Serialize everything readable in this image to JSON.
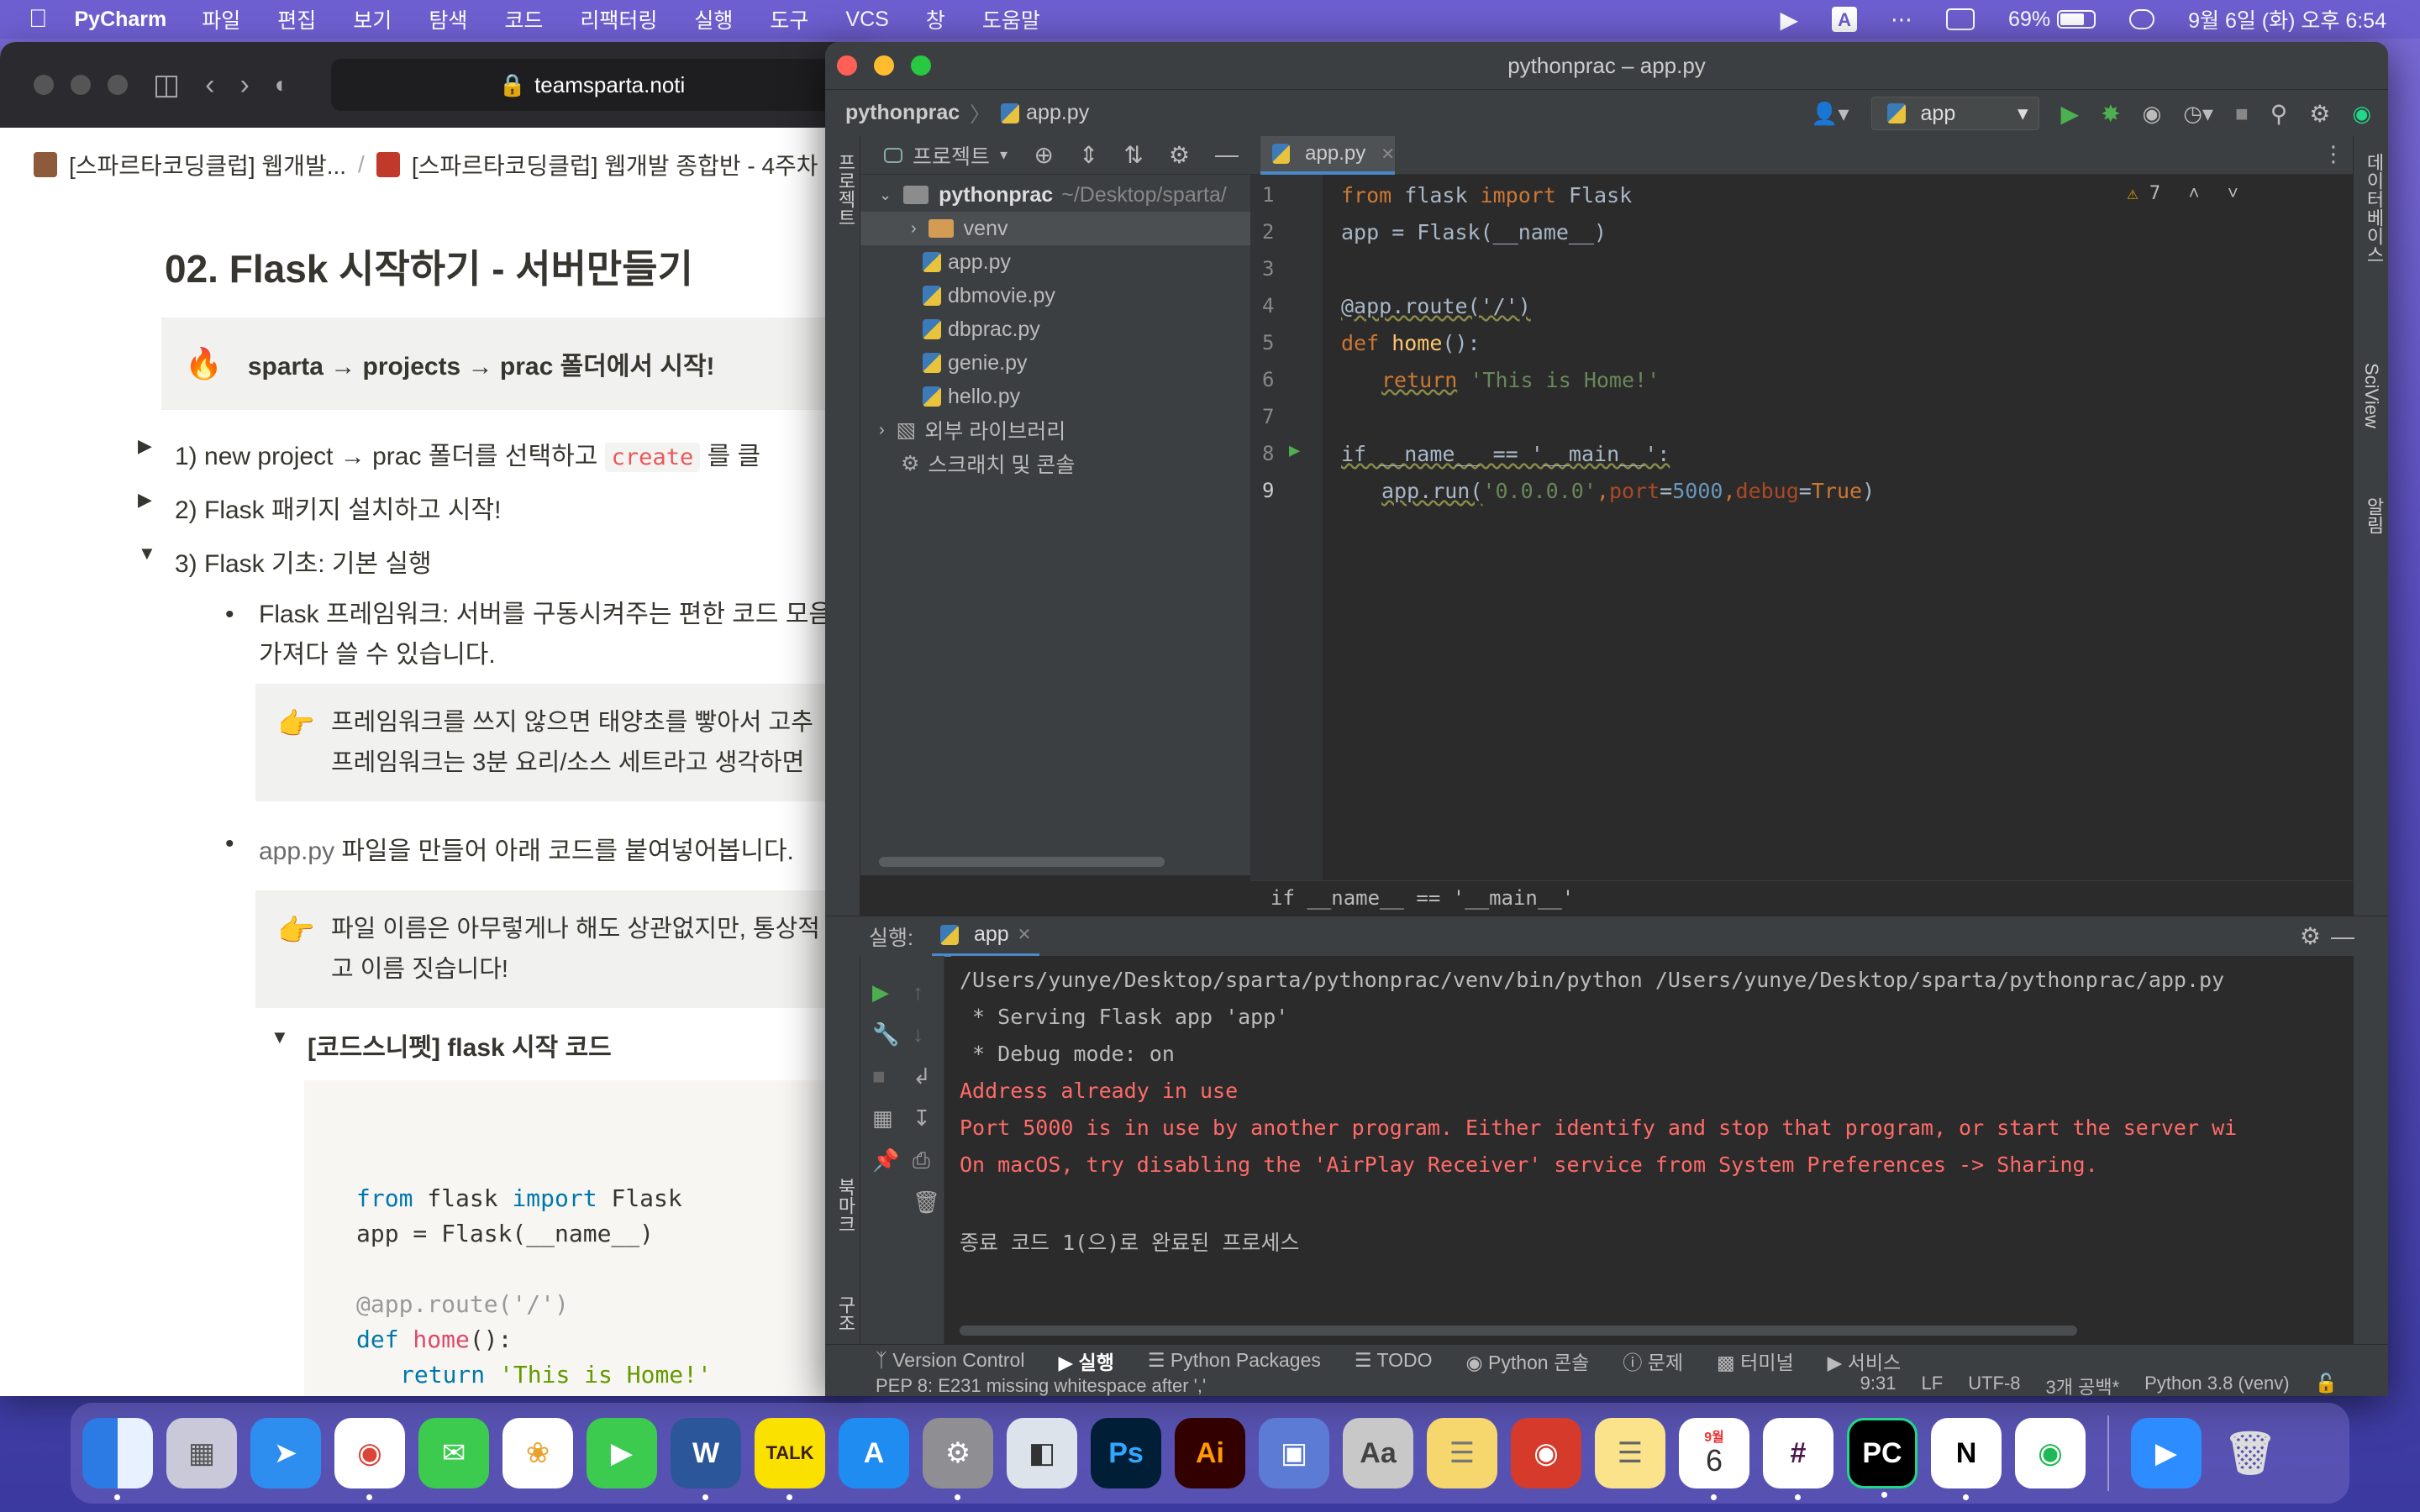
{
  "menubar": {
    "app_name": "PyCharm",
    "items": [
      "파일",
      "편집",
      "보기",
      "탐색",
      "코드",
      "리팩터링",
      "실행",
      "도구",
      "VCS",
      "창",
      "도움말"
    ],
    "battery": "69%",
    "datetime": "9월 6일 (화) 오후 6:54"
  },
  "browser": {
    "url": "teamsparta.noti",
    "breadcrumbs": [
      "[스파르타코딩클럽] 웹개발...",
      "[스파르타코딩클럽] 웹개발 종합반 - 4주차"
    ],
    "heading": "02. Flask 시작하기 - 서버만들기",
    "callout": "sparta → projects → prac 폴더에서 시작!",
    "toggles": [
      {
        "label": "1) new project → prac 폴더를 선택하고",
        "code": "create",
        "tail": "를 클"
      },
      {
        "label": "2) Flask 패키지 설치하고 시작!"
      },
      {
        "label": "3) Flask 기초: 기본 실행"
      }
    ],
    "bullet1_line1": "Flask 프레임워크: 서버를 구동시켜주는 편한 코드 모음",
    "bullet1_line2": "가져다 쓸 수 있습니다.",
    "quote1_line1": "프레임워크를 쓰지 않으면 태양초를 빻아서 고추",
    "quote1_line2": "프레임워크는 3분 요리/소스 세트라고 생각하면",
    "bullet2_file": "app.py",
    "bullet2_text": " 파일을 만들어 아래 코드를 붙여넣어봅니다.",
    "quote2_line1": "파일 이름은 아무렇게나 해도 상관없지만, 통상적",
    "quote2_line2": "고 이름 짓습니다!",
    "snippet_toggle": "[코드스니펫] flask 시작 코드",
    "snippet": {
      "l1_kw1": "from",
      "l1_mod": " flask ",
      "l1_kw2": "import",
      "l1_cls": " Flask",
      "l2": "app = Flask(__name__)",
      "l4": "@app.route('/')",
      "l5_kw": "def",
      "l5_fn": " home",
      "l5_rest": "():",
      "l6_kw": "return",
      "l6_str": " 'This is Home!'"
    }
  },
  "pycharm": {
    "window_title": "pythonprac – app.py",
    "nav_project": "pythonprac",
    "nav_file": "app.py",
    "run_config": "app",
    "project_panel_title": "프로젝트",
    "left_stripe_label": "프로젝트",
    "tree": {
      "root": "pythonprac",
      "root_path": "~/Desktop/sparta/",
      "venv": "venv",
      "files": [
        "app.py",
        "dbmovie.py",
        "dbprac.py",
        "genie.py",
        "hello.py"
      ],
      "ext_libs": "외부 라이브러리",
      "scratches": "스크래치 및 콘솔"
    },
    "editor_tab": "app.py",
    "inspection_count": "7",
    "code": {
      "l1_from": "from",
      "l1_mod": " flask ",
      "l1_import": "import",
      "l1_cls": " Flask",
      "l2": "app = Flask(__name__)",
      "l4": "@app.route('/')",
      "l5_def": "def",
      "l5_fn": " home",
      "l5_rest": "():",
      "l6_ret": "return",
      "l6_str": " 'This is Home!'",
      "l8": "if __name__ == '__main__':",
      "l9_a": "app.run(",
      "l9_s": "'0.0.0.0'",
      "l9_c1": ",",
      "l9_p": "port",
      "l9_eq": "=",
      "l9_n": "5000",
      "l9_c2": ",",
      "l9_d": "debug",
      "l9_eq2": "=",
      "l9_t": "True",
      "l9_end": ")"
    },
    "line_numbers": [
      "1",
      "2",
      "3",
      "4",
      "5",
      "6",
      "7",
      "8",
      "9"
    ],
    "editor_breadcrumb": "if __name__ == '__main__'",
    "run_label": "실행:",
    "run_tab": "app",
    "console": [
      {
        "text": "/Users/yunye/Desktop/sparta/pythonprac/venv/bin/python /Users/yunye/Desktop/sparta/pythonprac/app.py",
        "type": "normal"
      },
      {
        "text": " * Serving Flask app 'app'",
        "type": "normal"
      },
      {
        "text": " * Debug mode: on",
        "type": "normal"
      },
      {
        "text": "Address already in use",
        "type": "error"
      },
      {
        "text": "Port 5000 is in use by another program. Either identify and stop that program, or start the server wi",
        "type": "error"
      },
      {
        "text": "On macOS, try disabling the 'AirPlay Receiver' service from System Preferences -> Sharing.",
        "type": "error"
      },
      {
        "text": "",
        "type": "normal"
      },
      {
        "text": "종료 코드 1(으)로 완료된 프로세스",
        "type": "normal"
      }
    ],
    "bottom_tabs": [
      "Version Control",
      "실행",
      "Python Packages",
      "TODO",
      "Python 콘솔",
      "문제",
      "터미널",
      "서비스"
    ],
    "status_message": "PEP 8: E231 missing whitespace after ','",
    "status_right": [
      "9:31",
      "LF",
      "UTF-8",
      "3개 공백*",
      "Python 3.8 (venv)"
    ],
    "right_stripe": [
      "데이터베이스",
      "SciView",
      "알림"
    ],
    "left_bottom_stripe": [
      "북마크",
      "구조"
    ]
  },
  "dock": {
    "apps": [
      "Finder",
      "Launchpad",
      "Safari",
      "Chrome",
      "Messages",
      "Photos",
      "FaceTime",
      "Word",
      "KakaoTalk",
      "App Store",
      "System Preferences",
      "Preview",
      "Photoshop",
      "Illustrator",
      "Image Capture",
      "Dictionary",
      "Stickies",
      "Photo Booth",
      "Notes",
      "Calendar",
      "Slack",
      "PyCharm",
      "Notion",
      "Spotify",
      "Zoom",
      "Trash"
    ],
    "calendar_month": "9월",
    "calendar_day": "6",
    "kakaotalk_label": "TALK"
  }
}
